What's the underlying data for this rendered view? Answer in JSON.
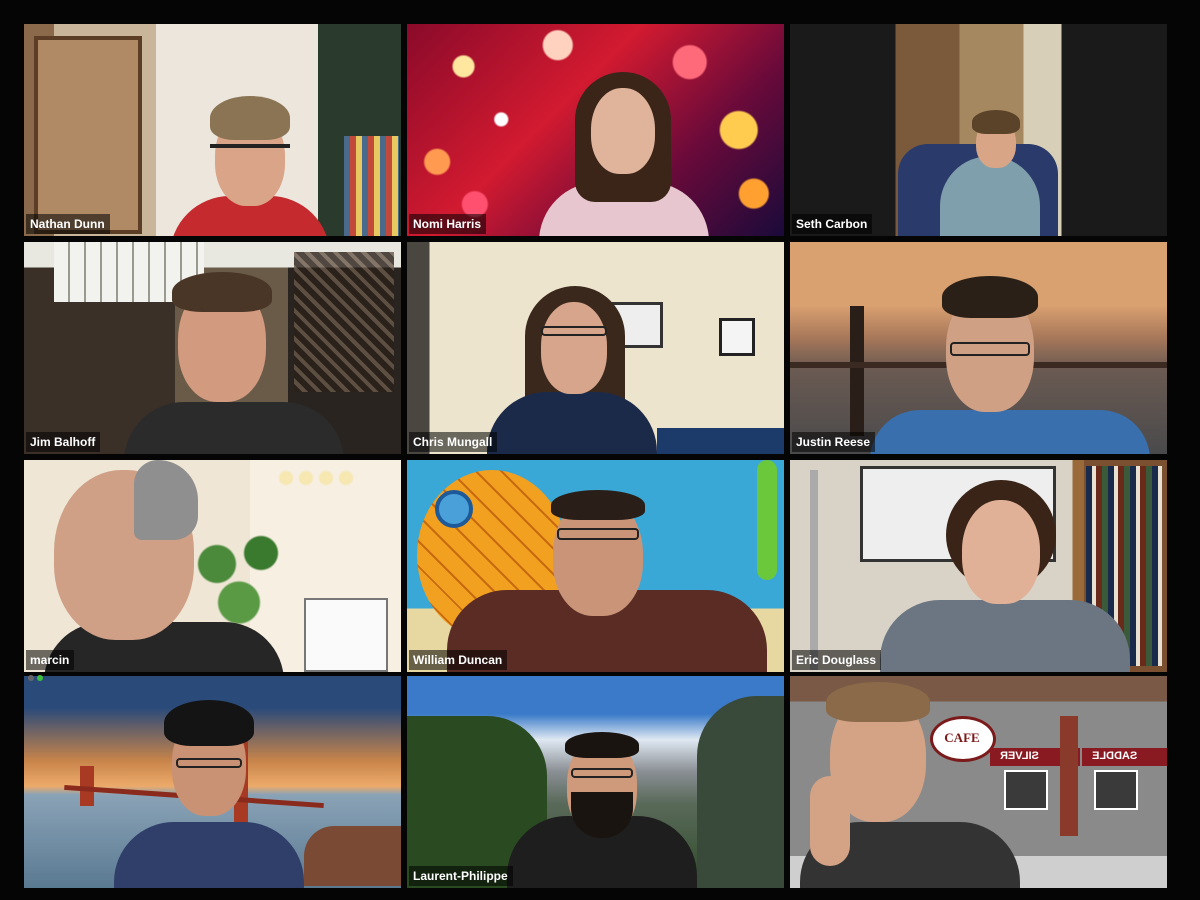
{
  "participants": [
    {
      "name": "Nathan Dunn",
      "bg": "room-doorway",
      "shirt": "#c42a2e",
      "skin": "#d9a487",
      "hair": "#8a7454"
    },
    {
      "name": "Nomi Harris",
      "bg": "bokeh-lights",
      "shirt": "#e8c6d0",
      "skin": "#e0b39b",
      "hair": "#3b2418"
    },
    {
      "name": "Seth Carbon",
      "bg": "dark-room-shelves",
      "shirt": "#7f9fad",
      "skin": "#d8a686",
      "hair": "#5a4328"
    },
    {
      "name": "Jim Balhoff",
      "bg": "museum-skeletons",
      "shirt": "#2b2b2b",
      "skin": "#d29a7e",
      "hair": "#4a3626"
    },
    {
      "name": "Chris Mungall",
      "bg": "beige-room",
      "shirt": "#1c2a4a",
      "skin": "#d6a58c",
      "hair": "#3a281c"
    },
    {
      "name": "Justin Reese",
      "bg": "golden-gate-sunset",
      "shirt": "#3a6fae",
      "skin": "#d0a085",
      "hair": "#2a2018"
    },
    {
      "name": "marcin",
      "bg": "bright-room-plant",
      "shirt": "#262626",
      "skin": "#cf9f86",
      "hair": "#8f8f8f"
    },
    {
      "name": "William Duncan",
      "bg": "pineapple-cartoon",
      "shirt": "#5a2c24",
      "skin": "#c99478",
      "hair": "#2a1e18"
    },
    {
      "name": "Eric Douglass",
      "bg": "room-bookshelf",
      "shirt": "#6b7682",
      "skin": "#e0b097",
      "hair": "#3a2418"
    },
    {
      "name": "",
      "bg": "golden-gate-bay",
      "shirt": "#2f3f6a",
      "skin": "#c99274",
      "hair": "#141414"
    },
    {
      "name": "Laurent-Philippe",
      "bg": "yosemite-valley",
      "shirt": "#1e1e1e",
      "skin": "#cf9a7c",
      "hair": "#1a1410"
    },
    {
      "name": "",
      "bg": "storefront-cafe",
      "shirt": "#333333",
      "skin": "#d4a285",
      "hair": "#8a6a48"
    }
  ],
  "cafe_sign": {
    "cafe": "CAFE",
    "silver": "SILVER",
    "saddle": "SADDLE"
  },
  "colors": {
    "active_speaker": "#e8e070",
    "background": "#000000",
    "name_tag_bg": "rgba(0,0,0,0.55)",
    "mute_indicator_1": "#666666",
    "mute_indicator_2": "#3fbf3f"
  }
}
